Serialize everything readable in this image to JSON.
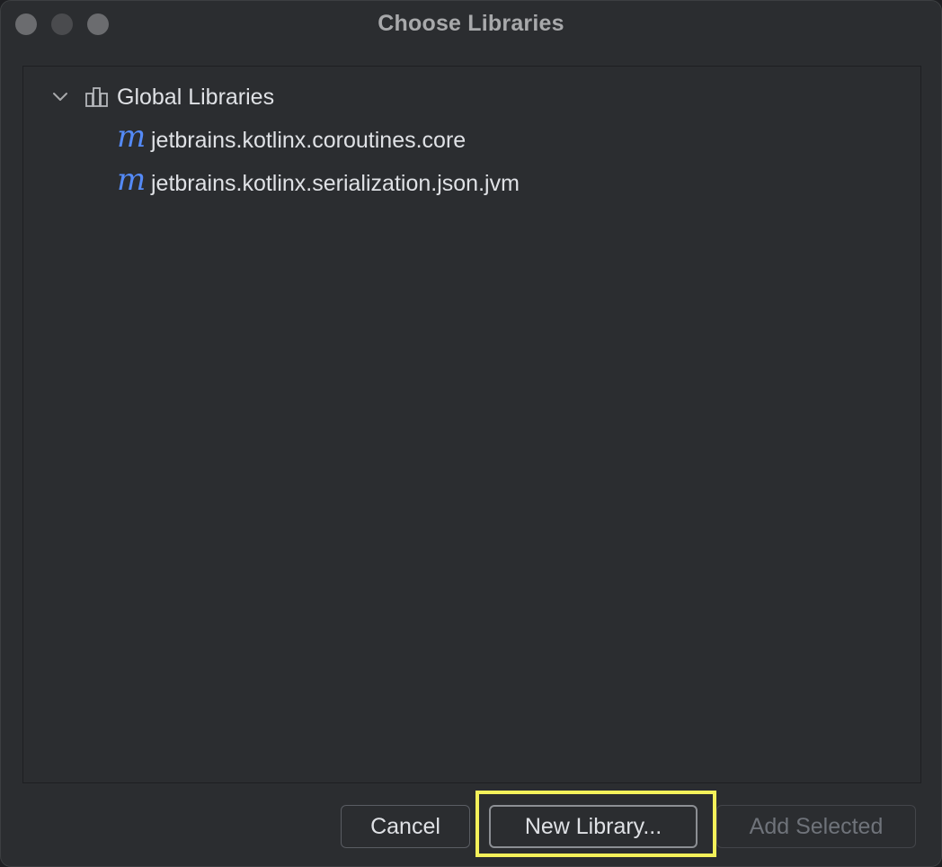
{
  "window": {
    "title": "Choose Libraries"
  },
  "tree": {
    "root": {
      "label": "Global Libraries",
      "expanded": true,
      "icon": "library-icon"
    },
    "items": [
      {
        "label": "jetbrains.kotlinx.coroutines.core",
        "icon": "maven-icon",
        "icon_glyph": "m"
      },
      {
        "label": "jetbrains.kotlinx.serialization.json.jvm",
        "icon": "maven-icon",
        "icon_glyph": "m"
      }
    ]
  },
  "buttons": {
    "cancel_label": "Cancel",
    "new_library_label": "New Library...",
    "add_selected_label": "Add Selected",
    "add_selected_enabled": false
  },
  "colors": {
    "background": "#2b2d30",
    "text": "#dfe1e5",
    "accent_icon": "#548af7",
    "highlight": "#f4f15a"
  }
}
